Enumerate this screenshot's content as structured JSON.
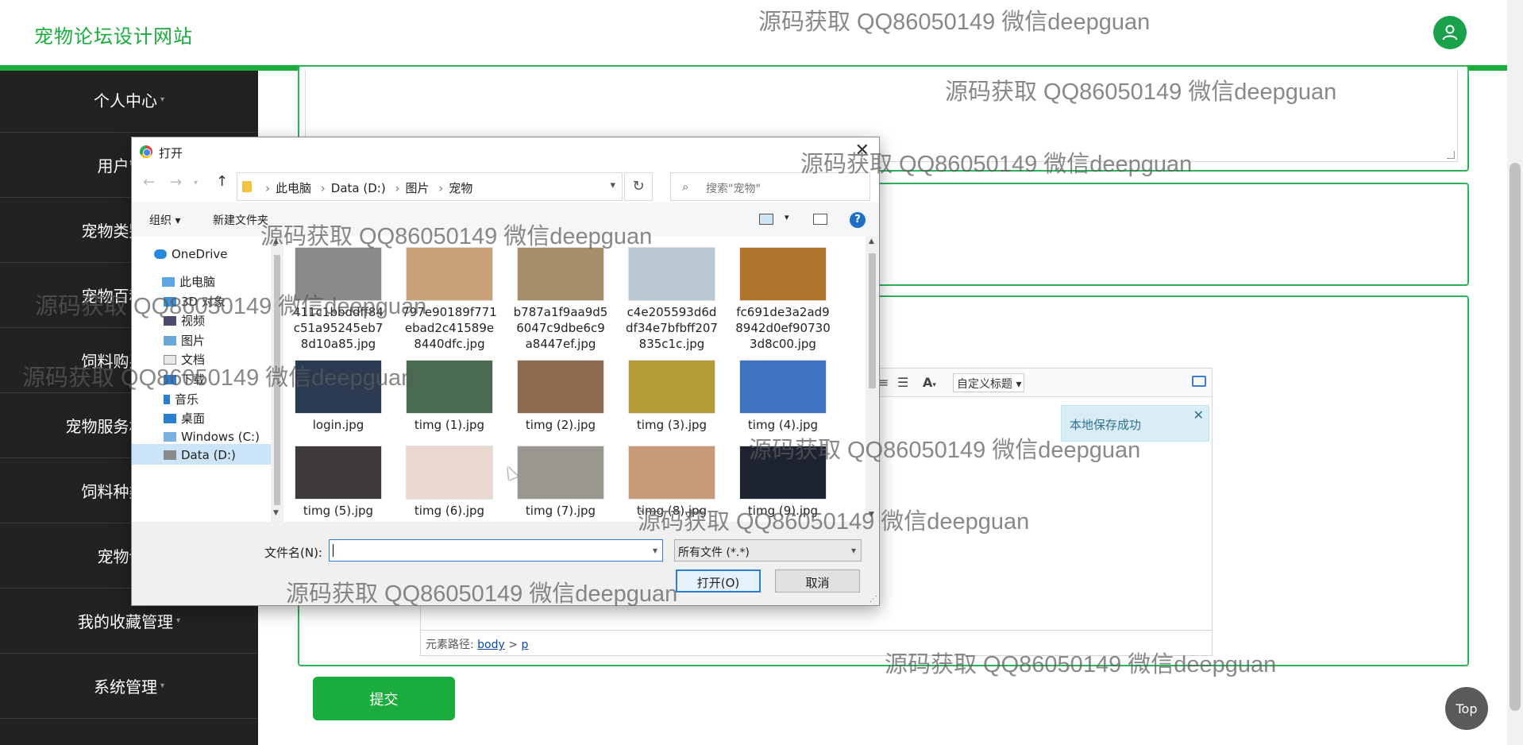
{
  "header": {
    "site_title": "宠物论坛设计网站",
    "avatar_icon": "user-icon",
    "brand_color": "#1aad3d"
  },
  "sidebar": {
    "items": [
      {
        "label": "个人中心"
      },
      {
        "label": "用户管理"
      },
      {
        "label": "宠物类别管理"
      },
      {
        "label": "宠物百科管理"
      },
      {
        "label": "饲料购买管理"
      },
      {
        "label": "宠物服务机构管理"
      },
      {
        "label": "饲料种类管理"
      },
      {
        "label": "宠物论坛"
      },
      {
        "label": "我的收藏管理"
      },
      {
        "label": "系统管理"
      }
    ]
  },
  "editor": {
    "toolbar_select": "自定义标题",
    "path_label": "元素路径:",
    "path_body": "body",
    "path_sep": ">",
    "path_p": "p",
    "notice": "本地保存成功"
  },
  "submit_label": "提交",
  "top_label": "Top",
  "dialog": {
    "title": "打开",
    "breadcrumb": [
      "此电脑",
      "Data (D:)",
      "图片",
      "宠物"
    ],
    "search_placeholder": "搜索\"宠物\"",
    "organize_label": "组织 ▾",
    "new_folder_label": "新建文件夹",
    "nav_items": [
      {
        "label": "OneDrive",
        "icon": "cloud-icon"
      },
      {
        "label": "此电脑",
        "icon": "computer-icon"
      },
      {
        "label": "3D 对象",
        "icon": "cube-icon"
      },
      {
        "label": "视频",
        "icon": "video-icon"
      },
      {
        "label": "图片",
        "icon": "picture-icon"
      },
      {
        "label": "文档",
        "icon": "document-icon"
      },
      {
        "label": "下载",
        "icon": "download-icon"
      },
      {
        "label": "音乐",
        "icon": "music-icon"
      },
      {
        "label": "桌面",
        "icon": "desktop-icon"
      },
      {
        "label": "Windows (C:)",
        "icon": "drive-icon"
      },
      {
        "label": "Data (D:)",
        "icon": "drive-icon",
        "selected": true
      }
    ],
    "files": [
      {
        "name": "411c1bbddff84c51a95245eb78d10a85.jpg",
        "color": "#8a8a8a"
      },
      {
        "name": "797e90189f771ebad2c41589e8440dfc.jpg",
        "color": "#c9a27a"
      },
      {
        "name": "b787a1f9aa9d56047c9dbe6c9a8447ef.jpg",
        "color": "#a58e6a"
      },
      {
        "name": "c4e205593d6ddf34e7bfbff207835c1c.jpg",
        "color": "#b9c8d2"
      },
      {
        "name": "fc691de3a2ad98942d0ef907303d8c00.jpg",
        "color": "#b0752c"
      },
      {
        "name": "login.jpg",
        "color": "#2c3a52"
      },
      {
        "name": "timg (1).jpg",
        "color": "#4a6a52"
      },
      {
        "name": "timg (2).jpg",
        "color": "#8e6a4e"
      },
      {
        "name": "timg (3).jpg",
        "color": "#b59a38"
      },
      {
        "name": "timg (4).jpg",
        "color": "#3f72c0"
      },
      {
        "name": "timg (5).jpg",
        "color": "#3e3a3a"
      },
      {
        "name": "timg (6).jpg",
        "color": "#e8d8d0"
      },
      {
        "name": "timg (7).jpg",
        "color": "#9a9690"
      },
      {
        "name": "timg (8).jpg",
        "color": "#c79a7a"
      },
      {
        "name": "timg (9).jpg",
        "color": "#1d2330"
      }
    ],
    "filename_label": "文件名(N):",
    "filename_value": "",
    "filetype_value": "所有文件 (*.*)",
    "open_label": "打开(O)",
    "cancel_label": "取消"
  },
  "watermark": "源码获取 QQ86050149 微信deepguan"
}
